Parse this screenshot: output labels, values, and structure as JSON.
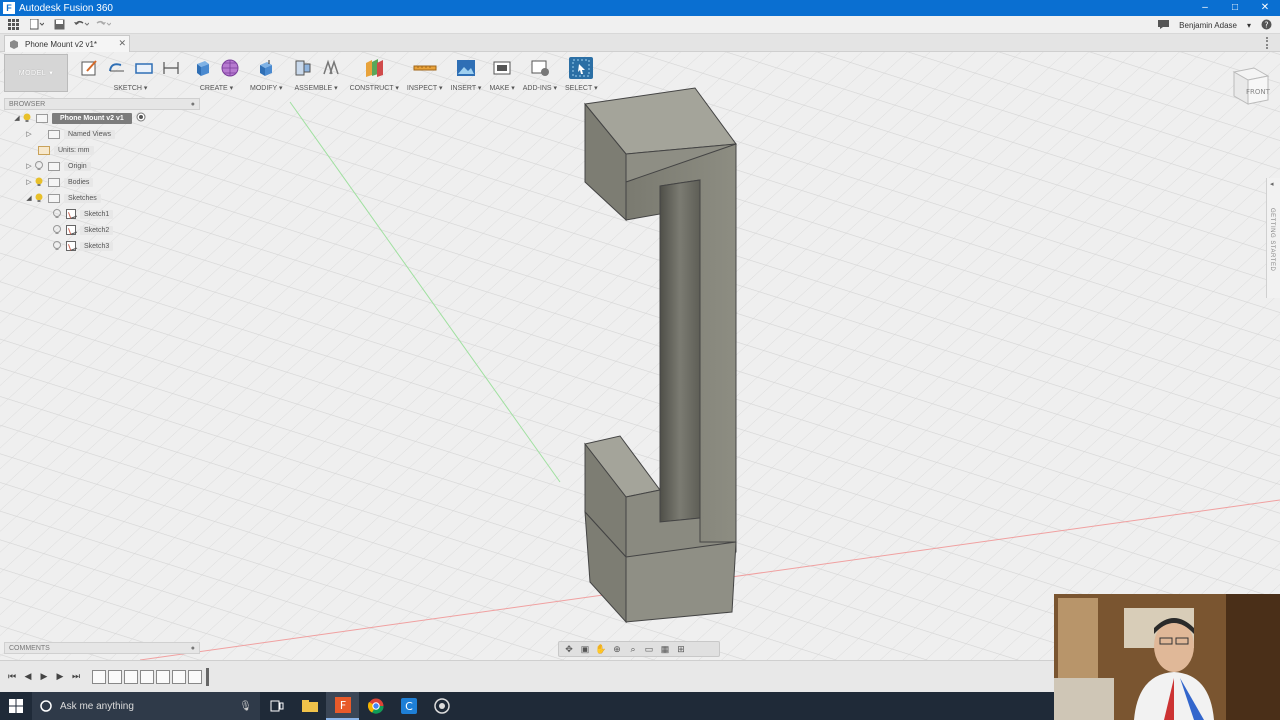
{
  "window": {
    "title": "Autodesk Fusion 360",
    "app_icon": "F",
    "controls": [
      "–",
      "□",
      "✕"
    ]
  },
  "qat": {
    "user": "Benjamin Adase"
  },
  "document_tab": {
    "title": "Phone Mount v2 v1*",
    "close": "✕"
  },
  "toolbar": {
    "mode": "MODEL",
    "groups": [
      "SKETCH",
      "CREATE",
      "MODIFY",
      "ASSEMBLE",
      "CONSTRUCT",
      "INSPECT",
      "INSERT",
      "MAKE",
      "ADD-INS",
      "SELECT"
    ]
  },
  "browser": {
    "header": "BROWSER",
    "root": "Phone Mount v2 v1",
    "items": [
      {
        "label": "Named Views"
      },
      {
        "label": "Units: mm"
      },
      {
        "label": "Origin"
      },
      {
        "label": "Bodies"
      },
      {
        "label": "Sketches"
      },
      {
        "label": "Sketch1"
      },
      {
        "label": "Sketch2"
      },
      {
        "label": "Sketch3"
      }
    ]
  },
  "viewcube": {
    "face": "FRONT"
  },
  "side_panel": {
    "label": "GETTING STARTED"
  },
  "comments": {
    "header": "COMMENTS"
  },
  "taskbar": {
    "search_placeholder": "Ask me anything"
  },
  "colors": {
    "title_bar": "#0a6fd1",
    "model_face_light": "#8b8b80",
    "model_face_dark": "#5d5d55",
    "taskbar": "#1f2a38"
  },
  "icons": {
    "grid": "grid-menu-icon",
    "save": "save-icon",
    "undo": "undo-icon",
    "redo": "redo-icon",
    "help": "help-icon",
    "notifications": "chat-icon"
  }
}
